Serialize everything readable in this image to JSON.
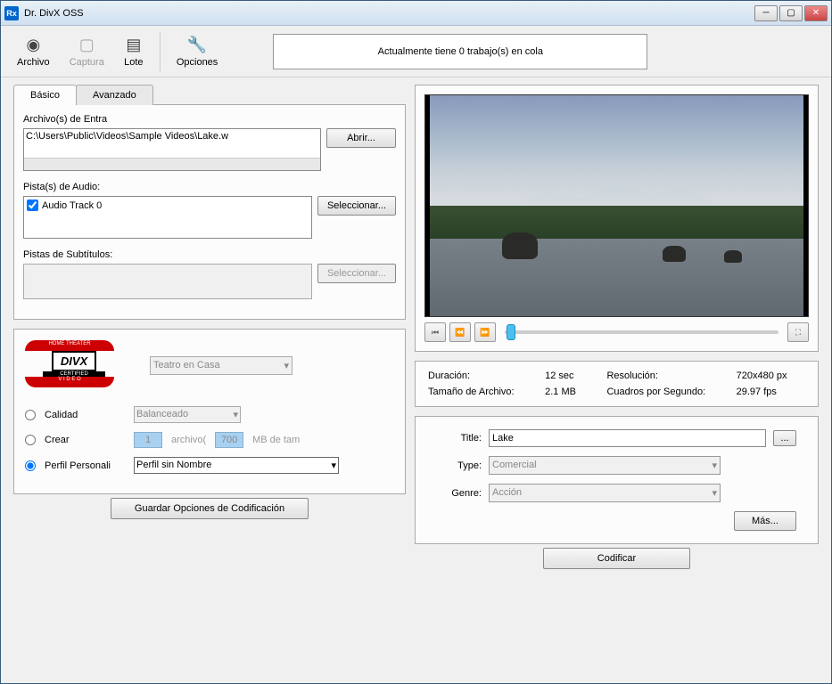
{
  "window": {
    "title": "Dr. DivX OSS",
    "icon_text": "Rx"
  },
  "toolbar": {
    "items": [
      {
        "label": "Archivo",
        "icon": "film-reel",
        "enabled": true
      },
      {
        "label": "Captura",
        "icon": "tv",
        "enabled": false
      },
      {
        "label": "Lote",
        "icon": "batch",
        "enabled": true
      },
      {
        "label": "Opciones",
        "icon": "wrench",
        "enabled": true
      }
    ],
    "status": "Actualmente tiene 0 trabajo(s) en cola"
  },
  "tabs": {
    "basic": "Básico",
    "advanced": "Avanzado"
  },
  "input_files": {
    "label": "Archivo(s) de Entra",
    "path": "C:\\Users\\Public\\Videos\\Sample Videos\\Lake.w",
    "open_btn": "Abrir..."
  },
  "audio": {
    "label": "Pista(s) de Audio:",
    "track": "Audio Track 0",
    "select_btn": "Seleccionar..."
  },
  "subtitles": {
    "label": "Pistas de Subtítulos:",
    "select_btn": "Seleccionar..."
  },
  "divx_logo": {
    "top": "HOME THEATER",
    "mid": "DIVX",
    "cert": "CERTIFIED",
    "bot": "V I D E O"
  },
  "profile": {
    "preset": "Teatro en Casa",
    "quality_label": "Calidad",
    "quality_value": "Balanceado",
    "create_label": "Crear",
    "create_count": "1",
    "create_mid": "archivo(",
    "create_size": "700",
    "create_suffix": "MB de tam",
    "custom_label": "Perfil Personali",
    "custom_value": "Perfil sin Nombre"
  },
  "save_btn": "Guardar Opciones de Codificación",
  "info": {
    "duration_label": "Duración:",
    "duration_value": "12 sec",
    "resolution_label": "Resolución:",
    "resolution_value": "720x480 px",
    "filesize_label": "Tamaño de Archivo:",
    "filesize_value": "2.1 MB",
    "fps_label": "Cuadros por Segundo:",
    "fps_value": "29.97 fps"
  },
  "meta": {
    "title_label": "Title:",
    "title_value": "Lake",
    "type_label": "Type:",
    "type_value": "Comercial",
    "genre_label": "Genre:",
    "genre_value": "Acción",
    "more_btn": "Más...",
    "browse_btn": "..."
  },
  "encode_btn": "Codificar"
}
